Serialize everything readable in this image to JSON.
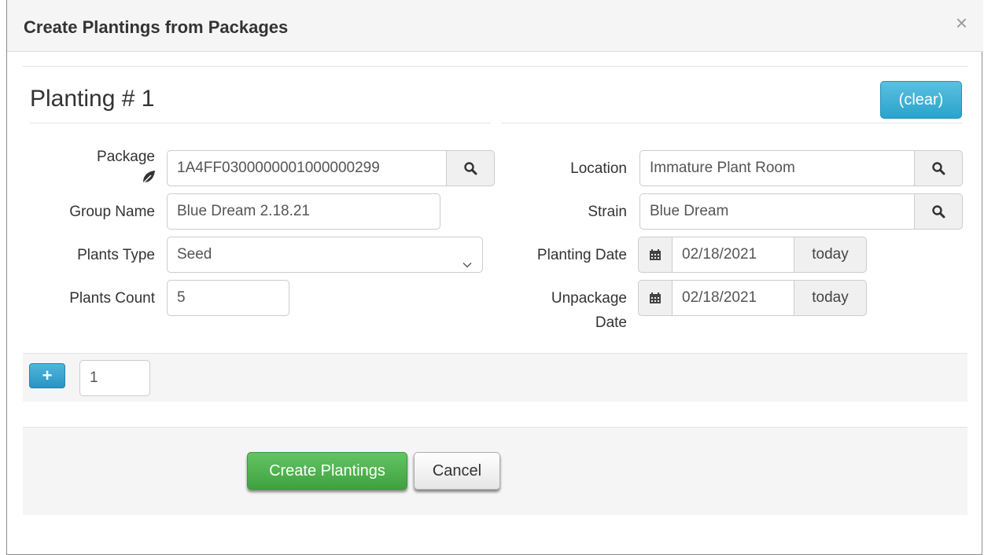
{
  "modal": {
    "title": "Create Plantings from Packages",
    "close_glyph": "×"
  },
  "planting": {
    "heading": "Planting # 1",
    "clear_label": "(clear)",
    "left": {
      "package_label": "Package",
      "package_value": "1A4FF0300000001000000299",
      "group_name_label": "Group Name",
      "group_name_value": "Blue Dream 2.18.21",
      "plants_type_label": "Plants Type",
      "plants_type_value": "Seed",
      "plants_count_label": "Plants Count",
      "plants_count_value": "5"
    },
    "right": {
      "location_label": "Location",
      "location_value": "Immature Plant Room",
      "strain_label": "Strain",
      "strain_value": "Blue Dream",
      "planting_date_label": "Planting Date",
      "planting_date_value": "02/18/2021",
      "unpackage_date_label_line1": "Unpackage",
      "unpackage_date_label_line2": "Date",
      "unpackage_date_value": "02/18/2021",
      "today_label": "today"
    }
  },
  "add_row": {
    "plus_glyph": "+",
    "count_value": "1"
  },
  "actions": {
    "create_label": "Create Plantings",
    "cancel_label": "Cancel"
  },
  "icons": {
    "package": "leaf-icon",
    "lookup": "search-icon",
    "date": "calendar-icon",
    "select": "chevron-down-icon",
    "add": "plus-icon"
  },
  "colors": {
    "info_button": "#2aa3cd",
    "success_button": "#3fa13f",
    "header_bg": "#f5f5f5"
  }
}
